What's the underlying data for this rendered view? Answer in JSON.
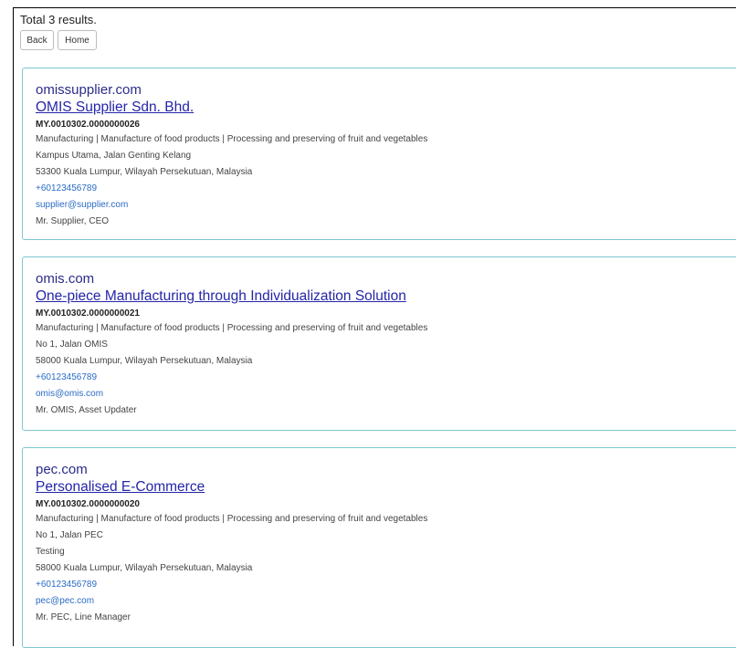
{
  "header": {
    "total_text": "Total 3 results.",
    "back_label": "Back",
    "home_label": "Home"
  },
  "results": [
    {
      "domain": "omissupplier.com",
      "company": "OMIS Supplier Sdn. Bhd.",
      "reg_no": "MY.0010302.0000000026",
      "industry": "Manufacturing | Manufacture of food products | Processing and preserving of fruit and vegetables",
      "address_lines": [
        "Kampus Utama, Jalan Genting Kelang",
        "53300 Kuala Lumpur, Wilayah Persekutuan, Malaysia"
      ],
      "phone": "+60123456789",
      "email": "supplier@supplier.com",
      "contact": "Mr. Supplier, CEO"
    },
    {
      "domain": "omis.com",
      "company": "One-piece Manufacturing through Individualization Solution",
      "reg_no": "MY.0010302.0000000021",
      "industry": "Manufacturing | Manufacture of food products | Processing and preserving of fruit and vegetables",
      "address_lines": [
        "No 1, Jalan OMIS",
        "58000 Kuala Lumpur, Wilayah Persekutuan, Malaysia"
      ],
      "phone": "+60123456789",
      "email": "omis@omis.com",
      "contact": "Mr. OMIS, Asset Updater"
    },
    {
      "domain": "pec.com",
      "company": "Personalised E-Commerce",
      "reg_no": "MY.0010302.0000000020",
      "industry": "Manufacturing | Manufacture of food products | Processing and preserving of fruit and vegetables",
      "address_lines": [
        "No 1, Jalan PEC",
        "Testing",
        "58000 Kuala Lumpur, Wilayah Persekutuan, Malaysia"
      ],
      "phone": "+60123456789",
      "email": "pec@pec.com",
      "contact": "Mr. PEC, Line Manager"
    }
  ],
  "colors": {
    "card_border": "#7ec8cf",
    "domain_text": "#2b2b8a",
    "company_link": "#2525a8",
    "contact_link": "#2a6cc4"
  }
}
